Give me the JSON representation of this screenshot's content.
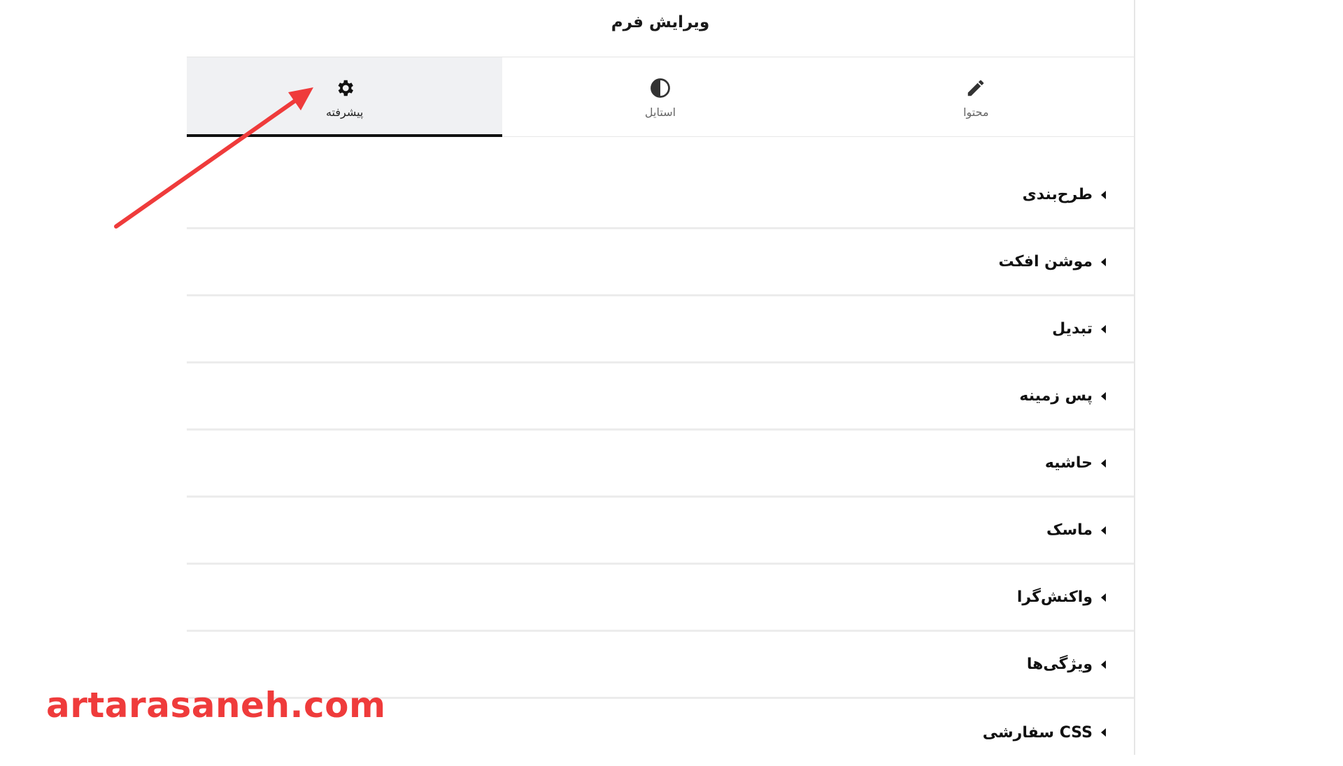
{
  "header": {
    "title": "ویرایش فرم"
  },
  "tabs": [
    {
      "label": "پیشرفته",
      "icon": "gear-icon",
      "active": true
    },
    {
      "label": "استایل",
      "icon": "contrast-icon",
      "active": false
    },
    {
      "label": "محتوا",
      "icon": "pencil-icon",
      "active": false
    }
  ],
  "sections": [
    {
      "label": "طرح‌بندی"
    },
    {
      "label": "موشن افکت"
    },
    {
      "label": "تبدیل"
    },
    {
      "label": "پس زمینه"
    },
    {
      "label": "حاشیه"
    },
    {
      "label": "ماسک"
    },
    {
      "label": "واکنش‌گرا"
    },
    {
      "label": "ویژگی‌ها"
    },
    {
      "label": "CSS سفارشی"
    }
  ],
  "watermark": {
    "text": "artarasaneh.com"
  },
  "colors": {
    "annotation_arrow": "#ef3b3b",
    "active_tab_bg": "#f0f1f3",
    "active_tab_underline": "#111111"
  }
}
